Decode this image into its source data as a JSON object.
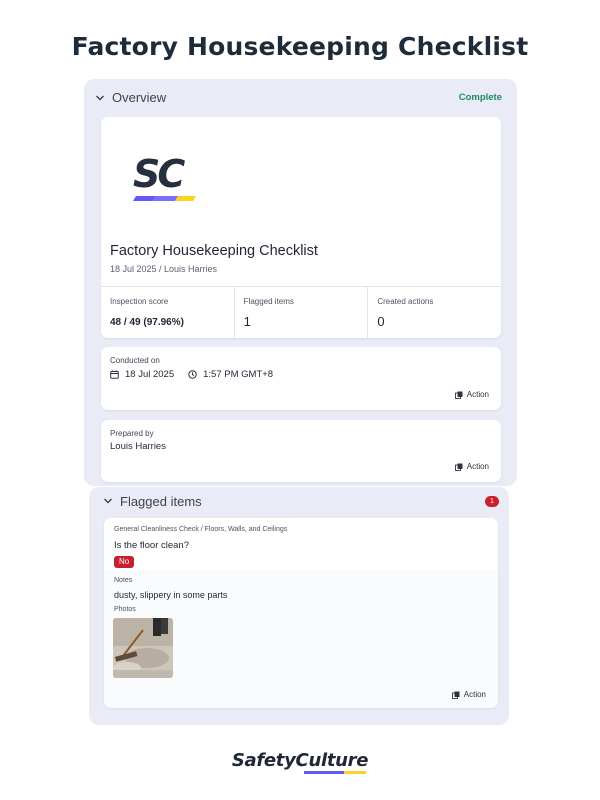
{
  "page": {
    "title": "Factory Housekeeping Checklist"
  },
  "overview": {
    "section_title": "Overview",
    "status": "Complete",
    "logo_text": "SC",
    "report_title": "Factory Housekeeping Checklist",
    "report_sub": "18 Jul 2025 / Louis Harries",
    "stats": [
      {
        "label": "Inspection score",
        "value": "48 / 49 (97.96%)"
      },
      {
        "label": "Flagged items",
        "value": "1"
      },
      {
        "label": "Created actions",
        "value": "0"
      }
    ],
    "conducted": {
      "label": "Conducted on",
      "date": "18 Jul 2025",
      "time": "1:57 PM GMT+8",
      "action_label": "Action"
    },
    "prepared": {
      "label": "Prepared by",
      "value": "Louis Harries",
      "action_label": "Action"
    }
  },
  "flagged": {
    "section_title": "Flagged items",
    "count": "1",
    "item": {
      "path": "General Cleanliness Check / Floors, Walls, and Ceilings",
      "question": "Is the floor clean?",
      "answer": "No",
      "notes_label": "Notes",
      "notes_text": "dusty, slippery in some parts",
      "photos_label": "Photos",
      "action_label": "Action"
    }
  },
  "footer": {
    "brand": "SafetyCulture"
  },
  "colors": {
    "panel_bg": "#e9ecf6",
    "complete_green": "#1f8a63",
    "flag_red": "#c8202f",
    "brand_purple": "#6559f5",
    "brand_yellow": "#ffd21f"
  },
  "icons": {
    "chevron": "chevron-down-icon",
    "calendar": "calendar-icon",
    "clock": "clock-icon",
    "action": "action-icon"
  }
}
